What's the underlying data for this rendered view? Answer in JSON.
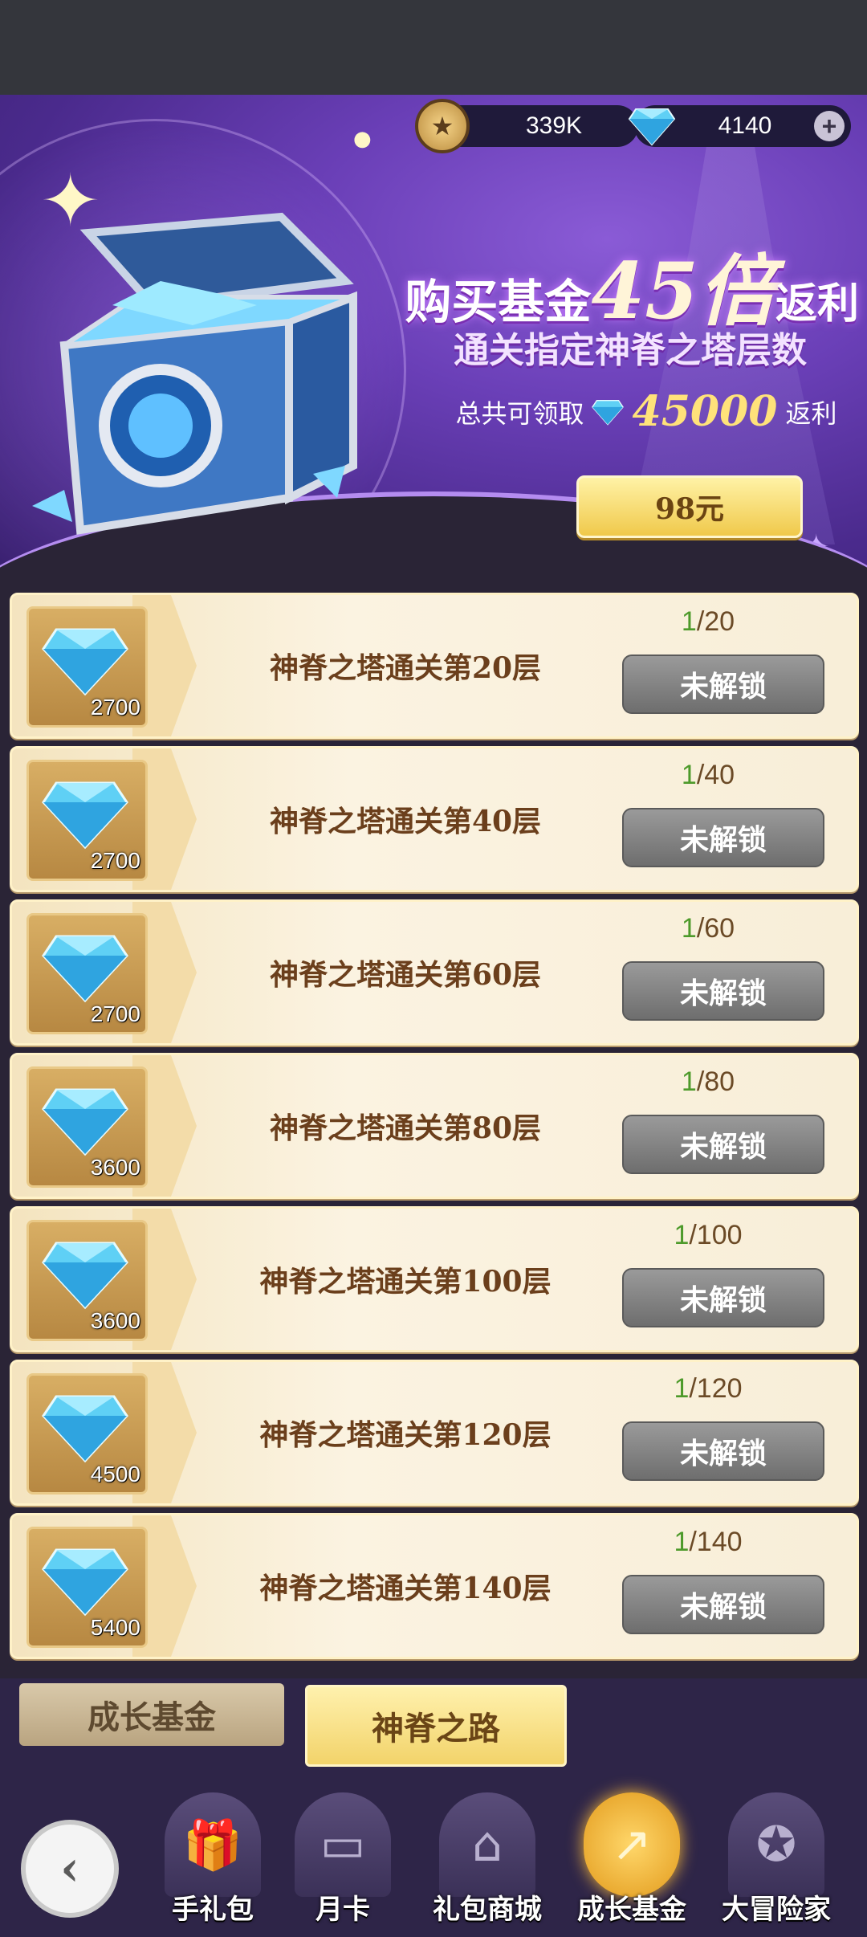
{
  "currency": {
    "gold": "339K",
    "gems": "4140",
    "add_symbol": "+"
  },
  "banner": {
    "headline_pre": "购买基金",
    "headline_num": "45倍",
    "headline_post": "返利",
    "subtitle": "通关指定神脊之塔层数",
    "total_prefix": "总共可领取",
    "total_amount": "45000",
    "total_suffix": "返利",
    "buy_label": "98元"
  },
  "rewards": [
    {
      "gems": "2700",
      "title": "神脊之塔通关第20层",
      "current": "1",
      "target": "/20",
      "button": "未解锁"
    },
    {
      "gems": "2700",
      "title": "神脊之塔通关第40层",
      "current": "1",
      "target": "/40",
      "button": "未解锁"
    },
    {
      "gems": "2700",
      "title": "神脊之塔通关第60层",
      "current": "1",
      "target": "/60",
      "button": "未解锁"
    },
    {
      "gems": "3600",
      "title": "神脊之塔通关第80层",
      "current": "1",
      "target": "/80",
      "button": "未解锁"
    },
    {
      "gems": "3600",
      "title": "神脊之塔通关第100层",
      "current": "1",
      "target": "/100",
      "button": "未解锁"
    },
    {
      "gems": "4500",
      "title": "神脊之塔通关第120层",
      "current": "1",
      "target": "/120",
      "button": "未解锁"
    },
    {
      "gems": "5400",
      "title": "神脊之塔通关第140层",
      "current": "1",
      "target": "/140",
      "button": "未解锁"
    }
  ],
  "subtabs": {
    "growth": "成长基金",
    "road": "神脊之路"
  },
  "nav": [
    {
      "label": "手礼包",
      "icon": "gift-icon"
    },
    {
      "label": "月卡",
      "icon": "card-icon"
    },
    {
      "label": "礼包商城",
      "icon": "shop-icon"
    },
    {
      "label": "成长基金",
      "icon": "growth-fund-icon"
    },
    {
      "label": "大冒险家",
      "icon": "adventurer-icon"
    }
  ],
  "colors": {
    "accent_purple": "#6a3fb7",
    "gold": "#f0c94b",
    "progress_green": "#4d9a2a",
    "locked_gray": "#7e7e7e"
  }
}
